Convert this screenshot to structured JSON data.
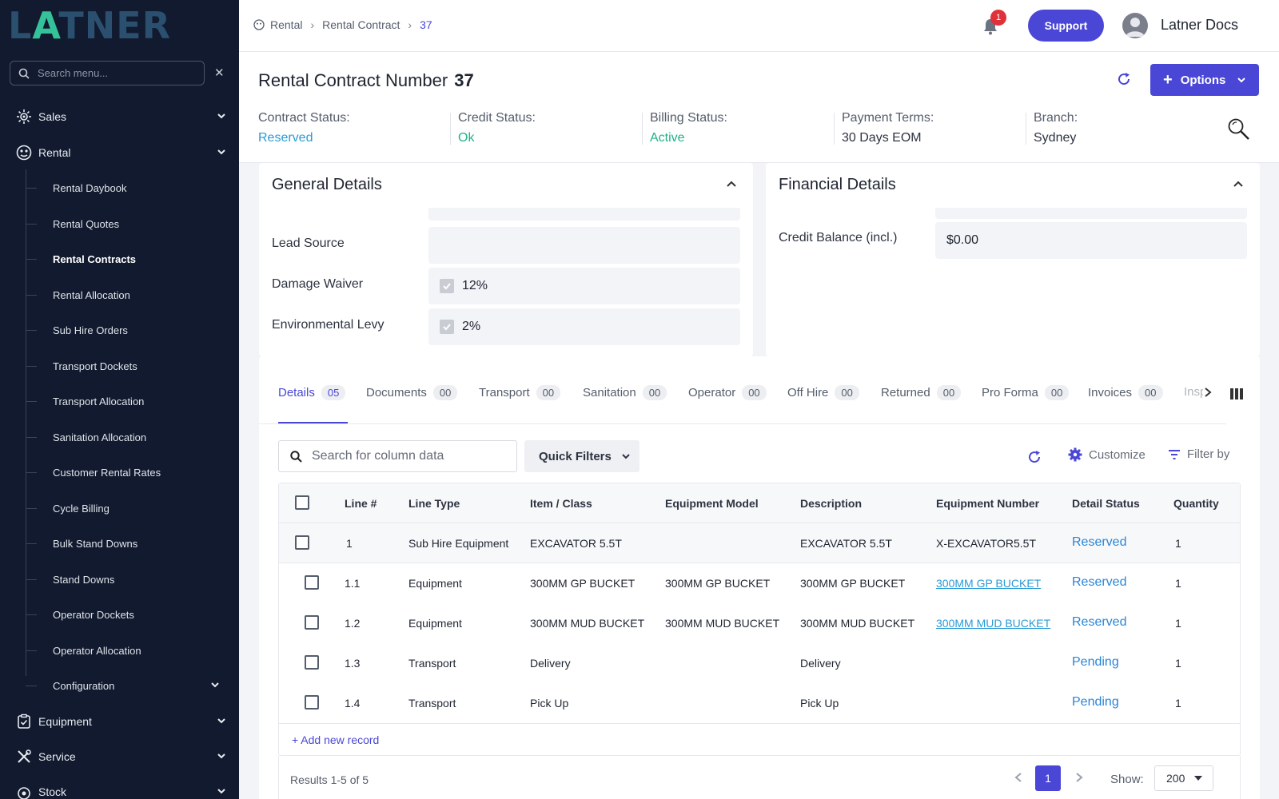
{
  "brand": {
    "logo_text_1": "L",
    "logo_text_a": "A",
    "logo_text_2": "TNER"
  },
  "sidebar": {
    "search_placeholder": "Search menu...",
    "top_items": [
      {
        "label": "Sales",
        "icon": "sales-icon"
      },
      {
        "label": "Rental",
        "icon": "rental-icon"
      },
      {
        "label": "Equipment",
        "icon": "equipment-icon"
      },
      {
        "label": "Service",
        "icon": "service-icon"
      },
      {
        "label": "Stock",
        "icon": "stock-icon"
      }
    ],
    "rental_items": [
      "Rental Daybook",
      "Rental Quotes",
      "Rental Contracts",
      "Rental Allocation",
      "Sub Hire Orders",
      "Transport Dockets",
      "Transport Allocation",
      "Sanitation Allocation",
      "Customer Rental Rates",
      "Cycle Billing",
      "Bulk Stand Downs",
      "Stand Downs",
      "Operator Dockets",
      "Operator Allocation",
      "Configuration"
    ],
    "active_item": "Rental Contracts"
  },
  "topbar": {
    "breadcrumb": [
      "Rental",
      "Rental Contract",
      "37"
    ],
    "notification_count": "1",
    "support_label": "Support",
    "user_name": "Latner Docs"
  },
  "header": {
    "title": "Rental Contract Number",
    "number": "37",
    "options_label": "Options",
    "statuses": [
      {
        "label": "Contract Status:",
        "value": "Reserved",
        "color": "#2a9ad6"
      },
      {
        "label": "Credit Status:",
        "value": "Ok",
        "color": "#1fb28a"
      },
      {
        "label": "Billing Status:",
        "value": "Active",
        "color": "#1fb28a"
      },
      {
        "label": "Payment Terms:",
        "value": "30 Days EOM",
        "color": "#2d3340"
      },
      {
        "label": "Branch:",
        "value": "Sydney",
        "color": "#2d3340"
      }
    ]
  },
  "general": {
    "title": "General Details",
    "fields": [
      {
        "label": "Lead Source",
        "value": ""
      },
      {
        "label": "Damage Waiver",
        "value": "12%"
      },
      {
        "label": "Environmental Levy",
        "value": "2%"
      }
    ]
  },
  "financial": {
    "title": "Financial Details",
    "fields": [
      {
        "label": "Credit Balance (incl.)",
        "value": "$0.00"
      }
    ]
  },
  "tabs": [
    {
      "label": "Details",
      "count": "05"
    },
    {
      "label": "Documents",
      "count": "00"
    },
    {
      "label": "Transport",
      "count": "00"
    },
    {
      "label": "Sanitation",
      "count": "00"
    },
    {
      "label": "Operator",
      "count": "00"
    },
    {
      "label": "Off Hire",
      "count": "00"
    },
    {
      "label": "Returned",
      "count": "00"
    },
    {
      "label": "Pro Forma",
      "count": "00"
    },
    {
      "label": "Invoices",
      "count": "00"
    },
    {
      "label": "Insp",
      "count": ""
    }
  ],
  "toolbar": {
    "search_placeholder": "Search for column data",
    "quick_filters": "Quick Filters",
    "customize": "Customize",
    "filter_by": "Filter by"
  },
  "table": {
    "columns": [
      "Line #",
      "Line Type",
      "Item / Class",
      "Equipment Model",
      "Description",
      "Equipment Number",
      "Detail Status",
      "Quantity"
    ],
    "rows": [
      {
        "line": "1",
        "type": "Sub Hire Equipment",
        "item": "EXCAVATOR 5.5T",
        "model": "",
        "desc": "EXCAVATOR 5.5T",
        "equip": "X-EXCAVATOR5.5T",
        "status": "Reserved",
        "qty": "1"
      },
      {
        "line": "1.1",
        "type": "Equipment",
        "item": "300MM GP BUCKET",
        "model": "300MM GP BUCKET",
        "desc": "300MM GP BUCKET",
        "equip": "300MM GP BUCKET",
        "status": "Reserved",
        "qty": "1"
      },
      {
        "line": "1.2",
        "type": "Equipment",
        "item": "300MM MUD BUCKET",
        "model": "300MM MUD BUCKET",
        "desc": "300MM MUD BUCKET",
        "equip": "300MM MUD BUCKET",
        "status": "Reserved",
        "qty": "1"
      },
      {
        "line": "1.3",
        "type": "Transport",
        "item": "Delivery",
        "model": "",
        "desc": "Delivery",
        "equip": "",
        "status": "Pending",
        "qty": "1"
      },
      {
        "line": "1.4",
        "type": "Transport",
        "item": "Pick Up",
        "model": "",
        "desc": "Pick Up",
        "equip": "",
        "status": "Pending",
        "qty": "1"
      }
    ],
    "add_label": "+ Add new record"
  },
  "pagination": {
    "results": "Results 1-5 of 5",
    "page": "1",
    "show_label": "Show:",
    "show_value": "200"
  },
  "colors": {
    "accent": "#4a47d6",
    "sidebar_bg": "#111a2e",
    "status_blue": "#2a85d6",
    "status_green": "#1fb28a"
  }
}
